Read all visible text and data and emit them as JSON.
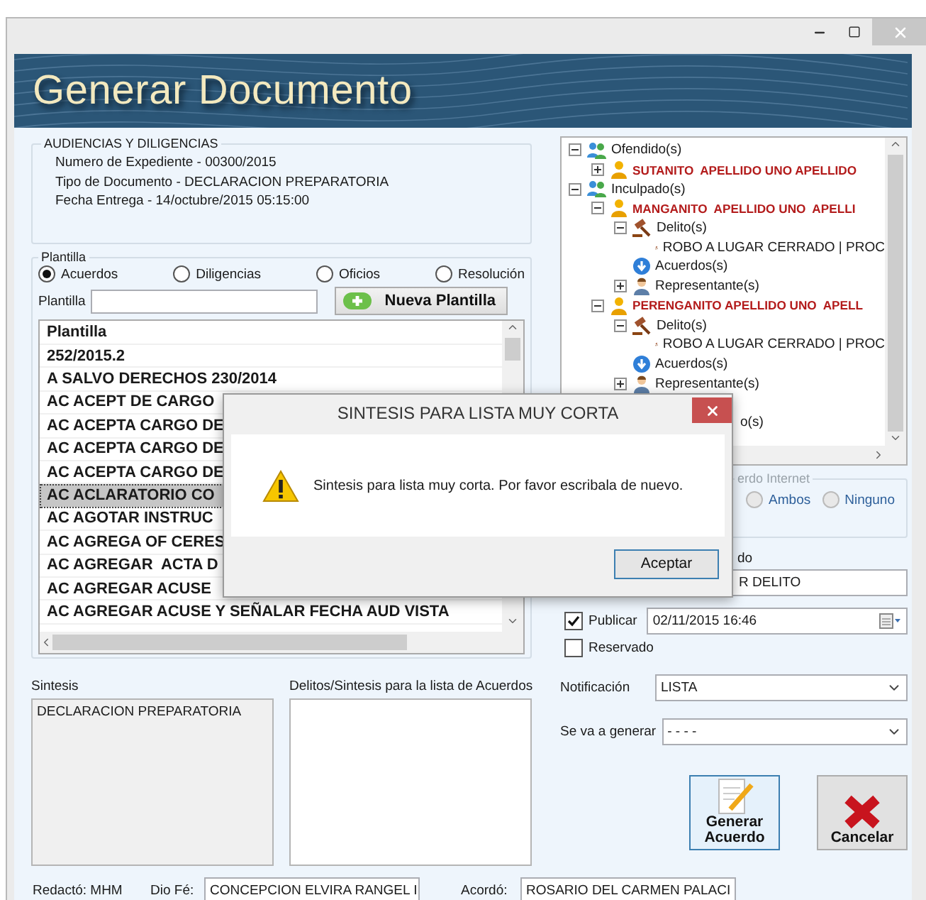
{
  "banner": {
    "title": "Generar Documento"
  },
  "audiencias": {
    "title": "AUDIENCIAS Y DILIGENCIAS",
    "lines": [
      "Numero de Expediente - 00300/2015",
      "Tipo de Documento - DECLARACION PREPARATORIA",
      "Fecha Entrega - 14/octubre/2015 05:15:00"
    ]
  },
  "plantilla": {
    "title": "Plantilla",
    "types": [
      {
        "label": "Acuerdos",
        "selected": true
      },
      {
        "label": "Diligencias",
        "selected": false
      },
      {
        "label": "Oficios",
        "selected": false
      },
      {
        "label": "Resolución",
        "selected": false
      }
    ],
    "search_label": "Plantilla",
    "new_button": "Nueva Plantilla",
    "list": {
      "header": "Plantilla",
      "rows": [
        {
          "text": "252/2015.2",
          "selected": false
        },
        {
          "text": "A SALVO DERECHOS 230/2014",
          "selected": false
        },
        {
          "text": "AC ACEPT DE CARGO",
          "selected": false
        },
        {
          "text": "AC ACEPTA CARGO DE",
          "selected": false
        },
        {
          "text": "AC ACEPTA CARGO DE",
          "selected": false
        },
        {
          "text": "AC ACEPTA CARGO DE",
          "selected": false
        },
        {
          "text": "AC ACLARATORIO CO",
          "selected": true
        },
        {
          "text": "AC AGOTAR INSTRUC",
          "selected": false
        },
        {
          "text": "AC AGREGA OF CERES",
          "selected": false
        },
        {
          "text": "AC AGREGAR  ACTA D",
          "selected": false
        },
        {
          "text": "AC AGREGAR ACUSE",
          "selected": false
        },
        {
          "text": "AC AGREGAR ACUSE Y SEÑALAR FECHA AUD VISTA",
          "selected": false
        }
      ]
    }
  },
  "tree": [
    {
      "label": "Ofendido(s)",
      "kind": "group",
      "expanded": true,
      "children": [
        {
          "label": "SUTANITO  APELLIDO UNO APELLIDO",
          "kind": "person",
          "expanded": false
        }
      ]
    },
    {
      "label": "Inculpado(s)",
      "kind": "group",
      "expanded": true,
      "children": [
        {
          "label": "MANGANITO  APELLIDO UNO  APELLI",
          "kind": "person",
          "expanded": true,
          "children": [
            {
              "label": "Delito(s)",
              "kind": "crimes",
              "expanded": true,
              "children": [
                {
                  "label": "ROBO A LUGAR CERRADO | PROC",
                  "kind": "crime"
                }
              ]
            },
            {
              "label": "Acuerdos(s)",
              "kind": "agreements"
            },
            {
              "label": "Representante(s)",
              "kind": "representative",
              "expanded": false
            }
          ]
        },
        {
          "label": "PERENGANITO APELLIDO UNO  APELL",
          "kind": "person",
          "expanded": true,
          "children": [
            {
              "label": "Delito(s)",
              "kind": "crimes",
              "expanded": true,
              "children": [
                {
                  "label": "ROBO A LUGAR CERRADO | PROC",
                  "kind": "crime"
                }
              ]
            },
            {
              "label": "Acuerdos(s)",
              "kind": "agreements"
            },
            {
              "label": "Representante(s)",
              "kind": "representative",
              "expanded": false
            }
          ]
        }
      ]
    },
    {
      "label": "o(s)",
      "kind": "fragment"
    }
  ],
  "internet": {
    "title": "erdo Internet",
    "options": [
      {
        "label": "Ambos",
        "selected": false
      },
      {
        "label": "Ninguno",
        "selected": false
      }
    ]
  },
  "field": {
    "label": "do",
    "value": "R DELITO"
  },
  "publicar": {
    "label": "Publicar",
    "checked": true,
    "value": "02/11/2015 16:46"
  },
  "reservado": {
    "label": "Reservado",
    "checked": false
  },
  "notificacion": {
    "label": "Notificación",
    "value": "LISTA"
  },
  "generar": {
    "label": "Se va a generar",
    "value": "- - - -"
  },
  "actions": [
    {
      "kind": "generate",
      "label": "Generar Acuerdo",
      "focused": true
    },
    {
      "kind": "cancel",
      "label": "Cancelar",
      "focused": false
    }
  ],
  "sintesis": {
    "label": "Sintesis",
    "value": "DECLARACION PREPARATORIA"
  },
  "delitos": {
    "label": "Delitos/Sintesis para la lista de Acuerdos"
  },
  "footer": {
    "redacto": "Redactó: MHM",
    "dio_fe_label": "Dio Fé:",
    "dio_fe_value": "CONCEPCION ELVIRA RANGEL I",
    "acordo_label": "Acordó:",
    "acordo_value": "ROSARIO DEL CARMEN PALACI"
  },
  "dialog": {
    "title": "SINTESIS PARA LISTA MUY CORTA",
    "message": "Sintesis para lista muy corta. Por favor escribala de nuevo.",
    "button": "Aceptar"
  }
}
